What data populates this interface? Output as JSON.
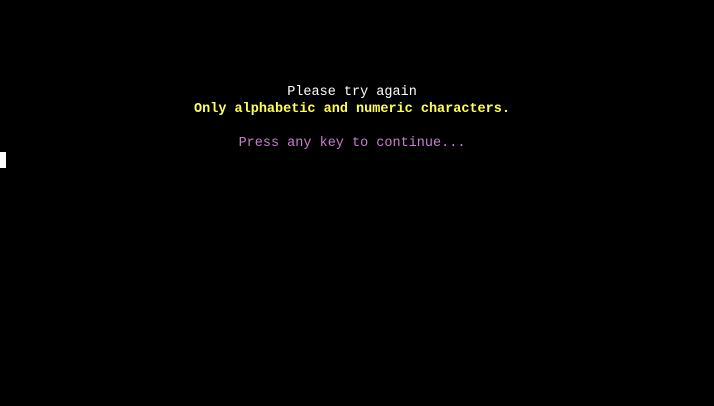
{
  "terminal": {
    "message": "Please try again",
    "error": "Only alphabetic and numeric characters.",
    "prompt": "Press any key to continue...",
    "colors": {
      "background": "#000000",
      "message": "#ffffff",
      "error": "#ffff55",
      "prompt": "#c77ecf",
      "cursor": "#ffffff"
    }
  }
}
